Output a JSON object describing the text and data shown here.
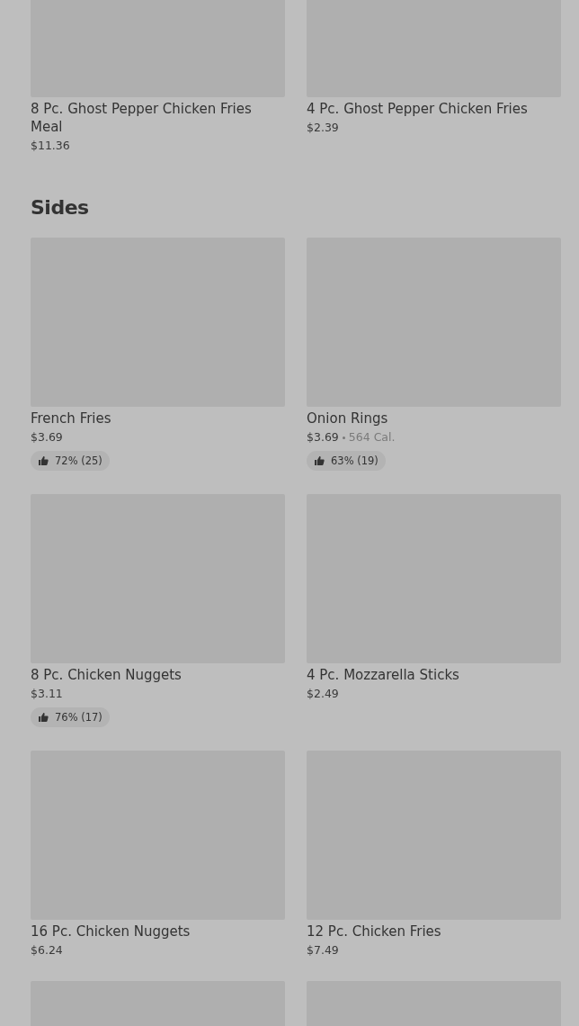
{
  "sections": [
    {
      "items": [
        {
          "kind": "item",
          "name": "8 Pc. Ghost Pepper Chicken Fries Meal",
          "price": "$11.36"
        },
        {
          "kind": "item",
          "name": "4 Pc. Ghost Pepper Chicken Fries",
          "price": "$2.39"
        }
      ]
    },
    {
      "title": "Sides",
      "items": [
        {
          "kind": "item",
          "name": "French Fries",
          "price": "$3.69",
          "rating": "72% (25)"
        },
        {
          "kind": "item",
          "name": "Onion Rings",
          "price": "$3.69",
          "calories": "564 Cal.",
          "rating": "63% (19)"
        },
        {
          "kind": "item",
          "name": "8 Pc. Chicken Nuggets",
          "price": "$3.11",
          "rating": "76% (17)"
        },
        {
          "kind": "item",
          "name": "4 Pc. Mozzarella Sticks",
          "price": "$2.49"
        },
        {
          "kind": "item",
          "name": "16 Pc. Chicken Nuggets",
          "price": "$6.24"
        },
        {
          "kind": "item",
          "name": "12 Pc. Chicken Fries",
          "price": "$7.49"
        },
        {
          "kind": "image-only"
        },
        {
          "kind": "image-only"
        }
      ]
    }
  ]
}
